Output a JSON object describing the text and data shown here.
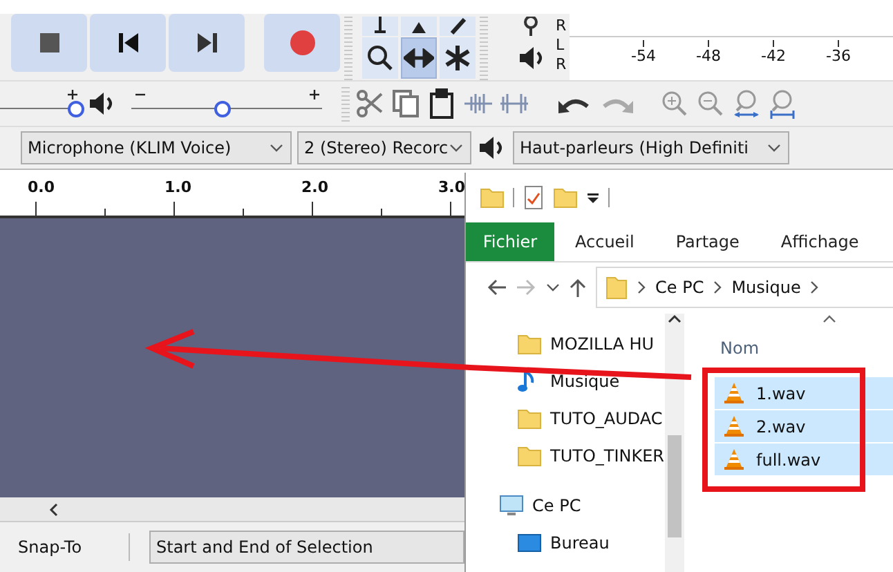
{
  "transport": {
    "buttons": [
      {
        "kind": "stop"
      },
      {
        "kind": "skip_start"
      },
      {
        "kind": "skip_end"
      },
      {
        "kind": "record"
      }
    ]
  },
  "tools": [
    {
      "kind": "zoom",
      "selected": false
    },
    {
      "kind": "time_shift",
      "selected": true
    },
    {
      "kind": "multi",
      "selected": false
    }
  ],
  "recording_meter": {
    "channels": [
      "R"
    ]
  },
  "playback_meter": {
    "channels": [
      "L",
      "R"
    ],
    "ticks": [
      "-54",
      "-48",
      "-42",
      "-36"
    ]
  },
  "recording_volume": {
    "level": 0.95
  },
  "playback_volume": {
    "level": 0.48
  },
  "devices": {
    "input": "Microphone (KLIM Voice)",
    "channels": "2 (Stereo) Recorc",
    "output": "Haut-parleurs (High Definiti"
  },
  "ruler": {
    "labels": [
      "0.0",
      "1.0",
      "2.0",
      "3.0"
    ]
  },
  "selection_toolbar": {
    "snap_label": "Snap-To",
    "mode": "Start and End of Selection"
  },
  "explorer": {
    "ribbon_tabs": [
      {
        "kind": "file_menu",
        "label": "Fichier"
      },
      {
        "kind": "tab",
        "label": "Accueil"
      },
      {
        "kind": "tab",
        "label": "Partage"
      },
      {
        "kind": "tab",
        "label": "Affichage"
      }
    ],
    "address": [
      "Ce PC",
      "Musique"
    ],
    "nav_items": [
      {
        "kind": "folder",
        "label": "MOZILLA HU"
      },
      {
        "kind": "music",
        "label": "Musique"
      },
      {
        "kind": "folder",
        "label": "TUTO_AUDAC"
      },
      {
        "kind": "folder",
        "label": "TUTO_TINKER"
      },
      {
        "kind": "pc",
        "label": "Ce PC"
      },
      {
        "kind": "desktop",
        "label": "Bureau"
      }
    ],
    "columns": [
      "Nom"
    ],
    "files": [
      {
        "name": "1.wav",
        "selected": true
      },
      {
        "name": "2.wav",
        "selected": true
      },
      {
        "name": "full.wav",
        "selected": true
      }
    ]
  }
}
